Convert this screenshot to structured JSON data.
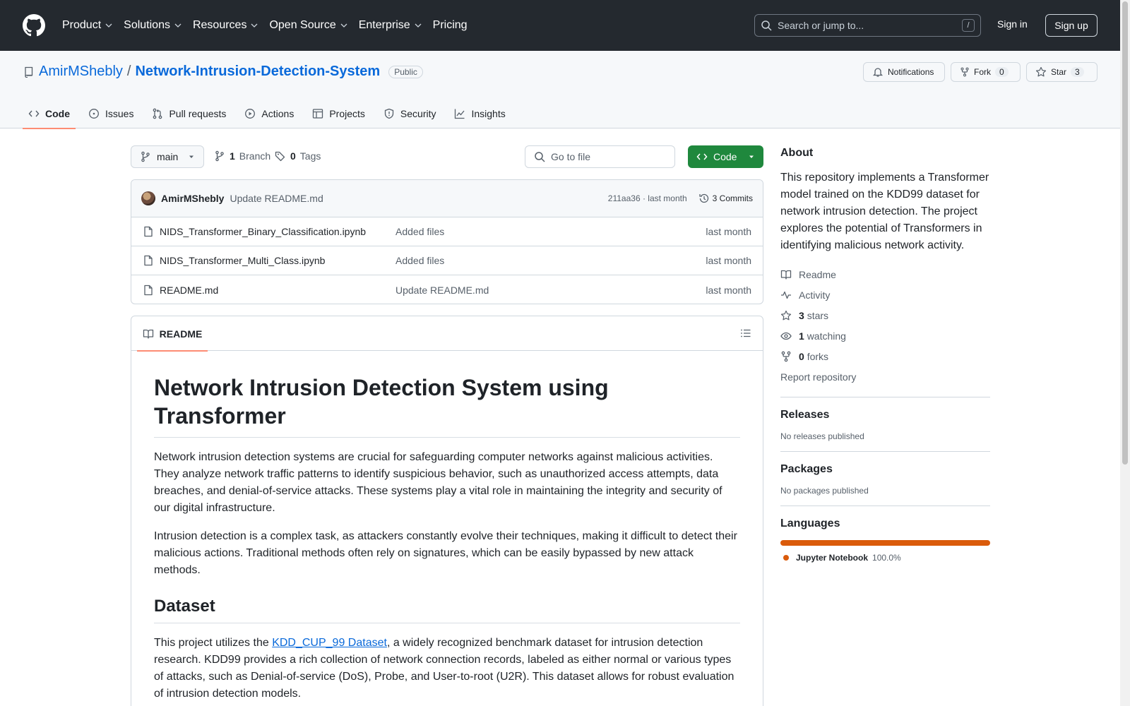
{
  "header": {
    "nav": [
      "Product",
      "Solutions",
      "Resources",
      "Open Source",
      "Enterprise",
      "Pricing"
    ],
    "search_placeholder": "Search or jump to...",
    "search_shortcut": "/",
    "signin": "Sign in",
    "signup": "Sign up"
  },
  "repo": {
    "owner": "AmirMShebly",
    "separator": "/",
    "name": "Network-Intrusion-Detection-System",
    "visibility": "Public",
    "notifications_label": "Notifications",
    "fork_label": "Fork",
    "fork_count": "0",
    "star_label": "Star",
    "star_count": "3"
  },
  "tabs": [
    "Code",
    "Issues",
    "Pull requests",
    "Actions",
    "Projects",
    "Security",
    "Insights"
  ],
  "branch": {
    "name": "main",
    "branch_count": "1",
    "branch_label": "Branch",
    "tag_count": "0",
    "tag_label": "Tags",
    "goto_placeholder": "Go to file",
    "code_label": "Code"
  },
  "commit": {
    "author": "AmirMShebly",
    "message": "Update README.md",
    "hash_time": "211aa36 · last month",
    "commits_label": "3 Commits"
  },
  "files": [
    {
      "name": "NIDS_Transformer_Binary_Classification.ipynb",
      "message": "Added files",
      "date": "last month"
    },
    {
      "name": "NIDS_Transformer_Multi_Class.ipynb",
      "message": "Added files",
      "date": "last month"
    },
    {
      "name": "README.md",
      "message": "Update README.md",
      "date": "last month"
    }
  ],
  "readme": {
    "tab_label": "README",
    "title": "Network Intrusion Detection System using Transformer",
    "p1": "Network intrusion detection systems are crucial for safeguarding computer networks against malicious activities. They analyze network traffic patterns to identify suspicious behavior, such as unauthorized access attempts, data breaches, and denial-of-service attacks. These systems play a vital role in maintaining the integrity and security of our digital infrastructure.",
    "p2": "Intrusion detection is a complex task, as attackers constantly evolve their techniques, making it difficult to detect their malicious actions. Traditional methods often rely on signatures, which can be easily bypassed by new attack methods.",
    "h_dataset": "Dataset",
    "p3_pre": "This project utilizes the ",
    "p3_link": "KDD_CUP_99 Dataset",
    "p3_post": ", a widely recognized benchmark dataset for intrusion detection research. KDD99 provides a rich collection of network connection records, labeled as either normal or various types of attacks, such as Denial-of-service (DoS), Probe, and User-to-root (U2R). This dataset allows for robust evaluation of intrusion detection models."
  },
  "about": {
    "heading": "About",
    "description": "This repository implements a Transformer model trained on the KDD99 dataset for network intrusion detection. The project explores the potential of Transformers in identifying malicious network activity.",
    "readme": "Readme",
    "activity": "Activity",
    "stars_count": "3",
    "stars_label": "stars",
    "watching_count": "1",
    "watching_label": "watching",
    "forks_count": "0",
    "forks_label": "forks",
    "report": "Report repository"
  },
  "releases": {
    "heading": "Releases",
    "text": "No releases published"
  },
  "packages": {
    "heading": "Packages",
    "text": "No packages published"
  },
  "languages": {
    "heading": "Languages",
    "items": [
      {
        "name": "Jupyter Notebook",
        "percent": "100.0%",
        "color": "#DA5B0B"
      }
    ]
  }
}
